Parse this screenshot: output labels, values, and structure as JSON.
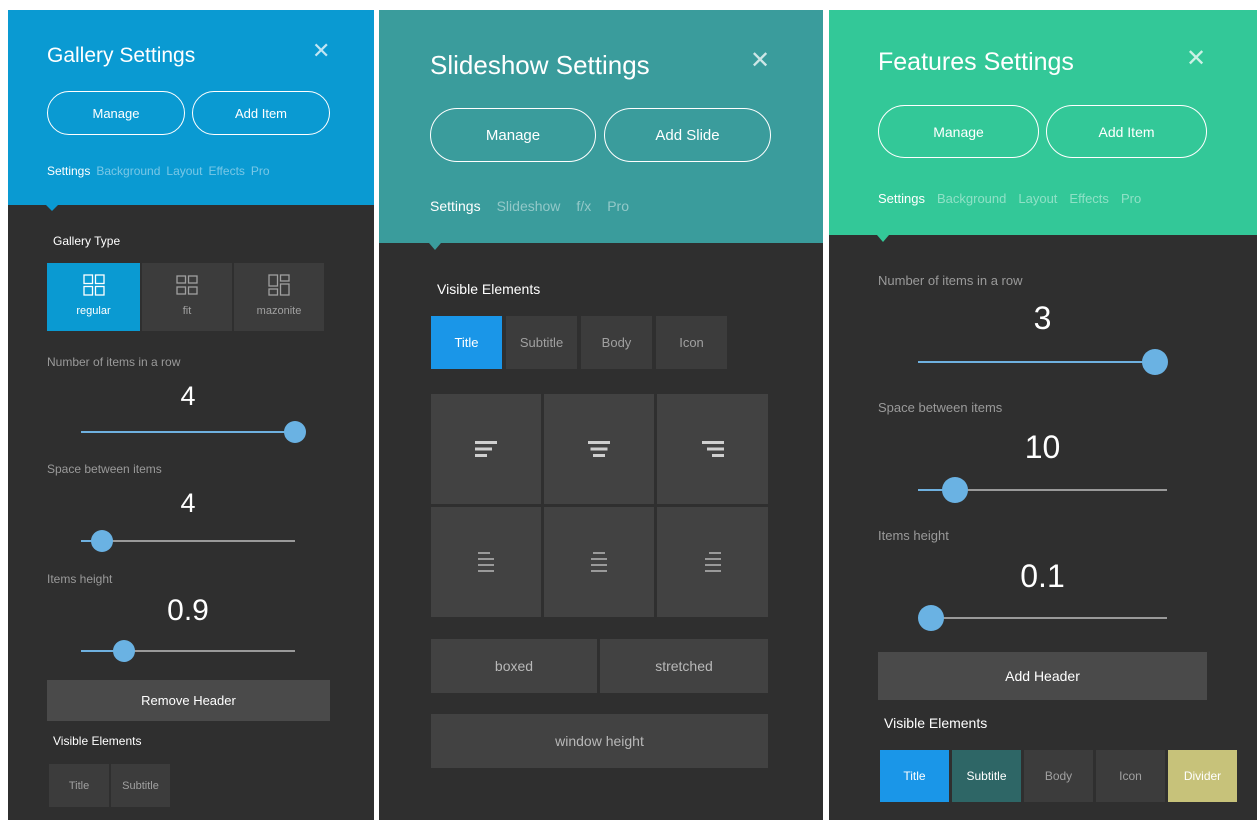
{
  "gallery": {
    "title": "Gallery Settings",
    "buttons": {
      "manage": "Manage",
      "add": "Add Item"
    },
    "tabs": [
      "Settings",
      "Background",
      "Layout",
      "Effects",
      "Pro"
    ],
    "gallery_type_label": "Gallery Type",
    "gallery_types": [
      "regular",
      "fit",
      "mazonite"
    ],
    "items_row": {
      "label": "Number of items in a row",
      "value": "4",
      "level": 1.0
    },
    "space": {
      "label": "Space between items",
      "value": "4",
      "level": 0.1
    },
    "height": {
      "label": "Items height",
      "value": "0.9",
      "level": 0.2
    },
    "remove_header": "Remove Header",
    "visible_label": "Visible Elements",
    "visible": [
      "Title",
      "Subtitle"
    ]
  },
  "slideshow": {
    "title": "Slideshow Settings",
    "buttons": {
      "manage": "Manage",
      "add": "Add Slide"
    },
    "tabs": [
      "Settings",
      "Slideshow",
      "f/x",
      "Pro"
    ],
    "visible_label": "Visible Elements",
    "visible": [
      "Title",
      "Subtitle",
      "Body",
      "Icon"
    ],
    "width_options": [
      "boxed",
      "stretched"
    ],
    "window_height": "window height"
  },
  "features": {
    "title": "Features Settings",
    "buttons": {
      "manage": "Manage",
      "add": "Add Item"
    },
    "tabs": [
      "Settings",
      "Background",
      "Layout",
      "Effects",
      "Pro"
    ],
    "items_row": {
      "label": "Number of items in a row",
      "value": "3",
      "level": 1.0
    },
    "space": {
      "label": "Space between items",
      "value": "10",
      "level": 0.15
    },
    "height": {
      "label": "Items height",
      "value": "0.1",
      "level": 0.0
    },
    "add_header": "Add Header",
    "visible_label": "Visible Elements",
    "visible": [
      "Title",
      "Subtitle",
      "Body",
      "Icon",
      "Divider"
    ]
  },
  "colors": {
    "gallery_header": "#0a9ad2",
    "slideshow_header": "#3a9c9c",
    "features_header": "#33c898",
    "panel_bg": "#2f2f2f",
    "active_blue": "#1a96e8",
    "subtitle_active": "#2e6666",
    "divider_active": "#c7c27a",
    "slider_knob": "#6ab2e3"
  },
  "icons": [
    "close-icon",
    "grid-regular-icon",
    "grid-fit-icon",
    "grid-mazonite-icon",
    "align-left-icon",
    "align-center-icon",
    "align-right-icon"
  ]
}
